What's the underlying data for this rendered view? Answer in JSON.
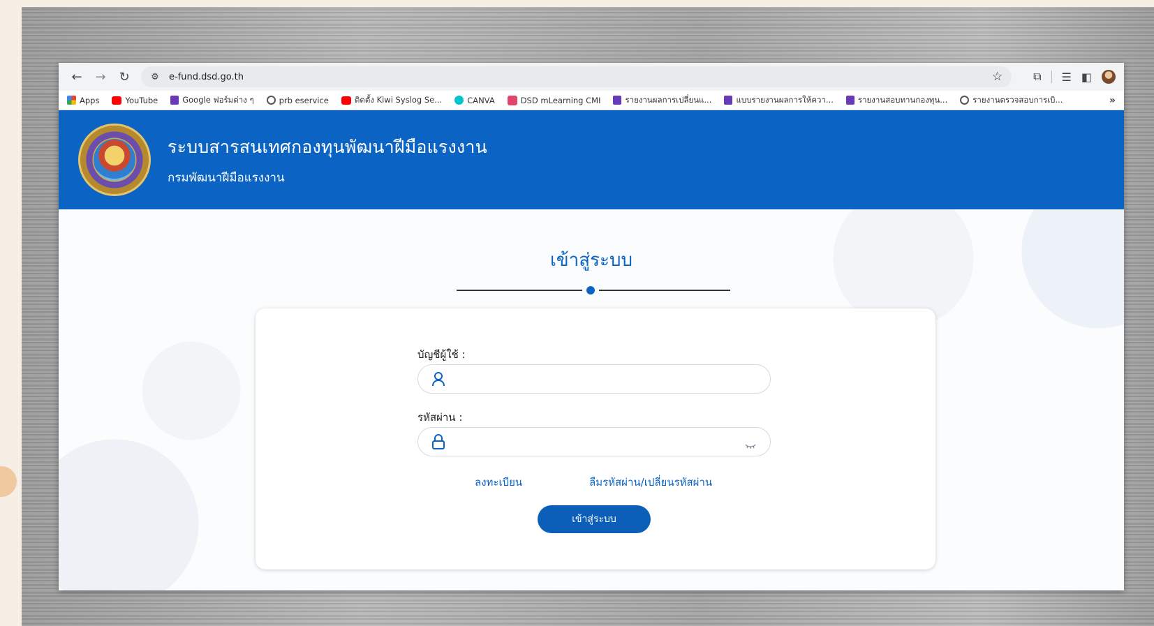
{
  "browser": {
    "url": "e-fund.dsd.go.th",
    "bookmarks": [
      {
        "label": "Apps",
        "icon": "apps-grid-icon"
      },
      {
        "label": "YouTube",
        "icon": "youtube-icon"
      },
      {
        "label": "Google ฟอร์มต่าง ๆ",
        "icon": "sheet-icon"
      },
      {
        "label": "prb eservice",
        "icon": "globe-icon"
      },
      {
        "label": "ติดตั้ง Kiwi Syslog Se...",
        "icon": "youtube-icon"
      },
      {
        "label": "CANVA",
        "icon": "canva-icon"
      },
      {
        "label": "DSD mLearning CMI",
        "icon": "dsd-icon"
      },
      {
        "label": "รายงานผลการเปลี่ยนแ...",
        "icon": "sheet-icon"
      },
      {
        "label": "แบบรายงานผลการให้ควา...",
        "icon": "sheet-icon"
      },
      {
        "label": "รายงานสอบทานกองทุน...",
        "icon": "sheet-icon"
      },
      {
        "label": "รายงานตรวจสอบการเบิ...",
        "icon": "globe-icon"
      }
    ],
    "more_bookmarks": "»"
  },
  "header": {
    "title": "ระบบสารสนเทศกองทุนพัฒนาฝีมือแรงงาน",
    "subtitle": "กรมพัฒนาฝีมือแรงงาน"
  },
  "login": {
    "title": "เข้าสู่ระบบ",
    "username_label": "บัญชีผู้ใช้ :",
    "username_value": "",
    "password_label": "รหัสผ่าน :",
    "password_value": "",
    "register_link": "ลงทะเบียน",
    "forgot_link": "ลืมรหัสผ่าน/เปลี่ยนรหัสผ่าน",
    "submit_label": "เข้าสู่ระบบ"
  },
  "colors": {
    "brand": "#0b63c4",
    "button": "#0b5fb9"
  }
}
